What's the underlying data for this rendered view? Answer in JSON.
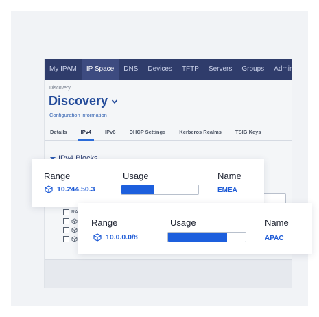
{
  "nav": {
    "items": [
      "My IPAM",
      "IP Space",
      "DNS",
      "Devices",
      "TFTP",
      "Servers",
      "Groups",
      "Administr"
    ],
    "active_index": 1
  },
  "page": {
    "breadcrumb": "Discovery",
    "title": "Discovery",
    "subtitle": "Configuration information"
  },
  "tabs": {
    "items": [
      "Details",
      "IPv4",
      "IPv6",
      "DHCP Settings",
      "Kerberos Realms",
      "TSIG Keys"
    ],
    "active_index": 1
  },
  "section": {
    "title": "IPv4 Blocks"
  },
  "background_rows": {
    "first_label": "RA"
  },
  "card1": {
    "range_header": "Range",
    "usage_header": "Usage",
    "name_header": "Name",
    "range": "10.244.50.3",
    "usage_fraction": 0.42,
    "name": "EMEA"
  },
  "card2": {
    "range_header": "Range",
    "usage_header": "Usage",
    "name_header": "Name",
    "range": "10.0.0.0/8",
    "usage_fraction": 0.76,
    "name": "APAC"
  },
  "colors": {
    "nav_bg": "#2f3c6b",
    "accent": "#1e5bd6",
    "title": "#234b9a",
    "bar_fill": "#1d5fdd"
  },
  "icons": [
    "chevron-down-icon",
    "caret-down-icon",
    "cube-icon",
    "plus-icon",
    "gear-icon",
    "undo-icon",
    "list-icon"
  ]
}
